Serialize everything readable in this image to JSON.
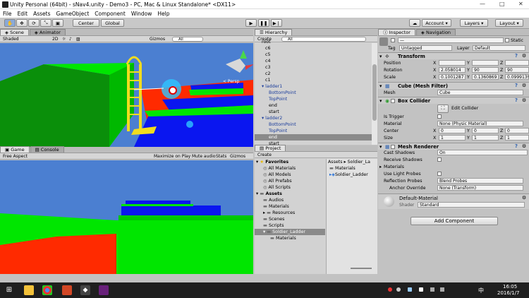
{
  "window": {
    "title": "Unity Personal (64bit) - sNav4.unity - Demo3 - PC, Mac & Linux Standalone* <DX11>",
    "minimize_glyph": "—",
    "maximize_glyph": "□",
    "close_glyph": "✕"
  },
  "menu": [
    "File",
    "Edit",
    "Assets",
    "GameObject",
    "Component",
    "Window",
    "Help"
  ],
  "toolbar": {
    "pivot": "Center",
    "space": "Global",
    "account": "Account",
    "layers": "Layers",
    "layout": "Layout"
  },
  "scene": {
    "tabs": [
      "Scene",
      "Animator"
    ],
    "shading": "Shaded",
    "mode": "2D",
    "gizmos": "Gizmos",
    "search": "All",
    "persp": "< Persp"
  },
  "game": {
    "tabs": [
      "Game",
      "Console"
    ],
    "aspect": "Free Aspect",
    "maximize": "Maximize on Play",
    "mute": "Mute audio",
    "stats": "Stats",
    "gizmos": "Gizmos"
  },
  "hierarchy": {
    "tab": "Hierarchy",
    "create": "Create",
    "search": "All",
    "items": [
      {
        "label": "root",
        "indent": 2,
        "blue": false,
        "expand": false
      },
      {
        "label": "c6",
        "indent": 3,
        "blue": false
      },
      {
        "label": "c5",
        "indent": 3,
        "blue": false
      },
      {
        "label": "c4",
        "indent": 3,
        "blue": false
      },
      {
        "label": "c3",
        "indent": 3,
        "blue": false
      },
      {
        "label": "c2",
        "indent": 3,
        "blue": false
      },
      {
        "label": "c1",
        "indent": 3,
        "blue": false
      },
      {
        "label": "ladder1",
        "indent": 2,
        "blue": true,
        "expand": true
      },
      {
        "label": "BottomPoint",
        "indent": 4,
        "blue": true
      },
      {
        "label": "TopPoint",
        "indent": 4,
        "blue": true
      },
      {
        "label": "end",
        "indent": 4,
        "blue": false
      },
      {
        "label": "start",
        "indent": 4,
        "blue": false
      },
      {
        "label": "ladder2",
        "indent": 2,
        "blue": true,
        "expand": true
      },
      {
        "label": "BottomPoint",
        "indent": 4,
        "blue": true
      },
      {
        "label": "TopPoint",
        "indent": 4,
        "blue": true
      },
      {
        "label": "end",
        "indent": 4,
        "blue": false,
        "sel": true
      },
      {
        "label": "start",
        "indent": 4,
        "blue": false
      }
    ]
  },
  "project": {
    "tabs": [
      "Project"
    ],
    "create": "Create",
    "favorites": {
      "label": "Favorites",
      "items": [
        "All Materials",
        "All Models",
        "All Prefabs",
        "All Scripts"
      ]
    },
    "assets": {
      "label": "Assets",
      "items": [
        "Audios",
        "Materials",
        "Resources",
        "Scenes",
        "Scripts",
        "Soldier_Ladder",
        "Materials"
      ]
    },
    "breadcrumb": "Assets ▸ Soldier_La",
    "right_items": [
      "Materials",
      "Soldier_Ladder"
    ]
  },
  "inspector": {
    "tabs": [
      "Inspector",
      "Navigation"
    ],
    "static": "Static",
    "name": "—",
    "tag_label": "Tag",
    "tag": "Untagged",
    "layer_label": "Layer",
    "layer": "Default",
    "transform": {
      "title": "Transform",
      "position": {
        "label": "Position",
        "x": "",
        "y": "",
        "z": ""
      },
      "rotation": {
        "label": "Rotation",
        "x": "2.058014",
        "y": "90",
        "z": "90"
      },
      "scale": {
        "label": "Scale",
        "x": "0.1001287",
        "y": "0.1360869",
        "z": "0.0999139"
      },
      "x": "X",
      "y": "Y",
      "z": "Z"
    },
    "mesh_filter": {
      "title": "Cube (Mesh Filter)",
      "mesh_label": "Mesh",
      "mesh": "Cube"
    },
    "box_collider": {
      "title": "Box Collider",
      "edit": "Edit Collider",
      "trigger_label": "Is Trigger",
      "material_label": "Material",
      "material": "None (Physic Material)",
      "center_label": "Center",
      "center": {
        "x": "0",
        "y": "0",
        "z": "0"
      },
      "size_label": "Size",
      "size": {
        "x": "1",
        "y": "1",
        "z": "1"
      }
    },
    "mesh_renderer": {
      "title": "Mesh Renderer",
      "cast_label": "Cast Shadows",
      "cast": "On",
      "receive_label": "Receive Shadows",
      "materials_label": "Materials",
      "probes_label": "Use Light Probes",
      "reflection_label": "Reflection Probes",
      "reflection": "Blend Probes",
      "anchor_label": "Anchor Override",
      "anchor": "None (Transform)"
    },
    "material": {
      "title": "Default-Material",
      "shader_label": "Shader",
      "shader": "Standard"
    },
    "add_component": "Add Component"
  },
  "taskbar": {
    "time": "16:05",
    "date": "2016/1/7",
    "lang": "中"
  },
  "colors": {
    "green": "#00e600",
    "blue": "#0a16f0",
    "red": "#ff2a00",
    "sky": "#4b7fd1",
    "ladder": "#f2dc1e"
  }
}
